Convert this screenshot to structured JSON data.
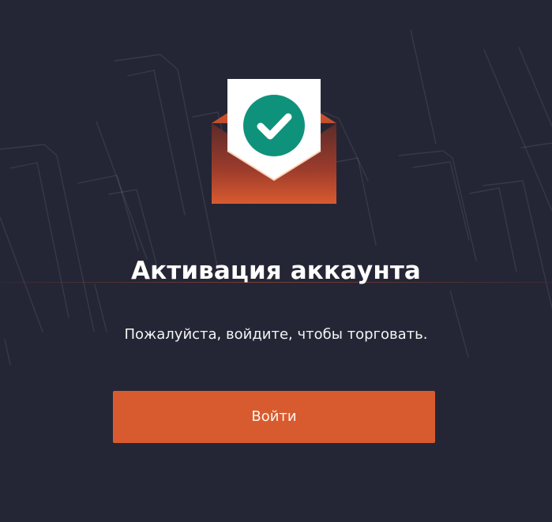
{
  "account_activation": {
    "title": "Активация аккаунта",
    "message": "Пожалуйста, войдите, чтобы торговать.",
    "login_button": "Войти"
  },
  "icons": {
    "illustration": "envelope-with-check-icon"
  },
  "colors": {
    "background": "#252635",
    "accent": "#d85b2f",
    "success": "#0f927b",
    "text": "#ffffff"
  }
}
